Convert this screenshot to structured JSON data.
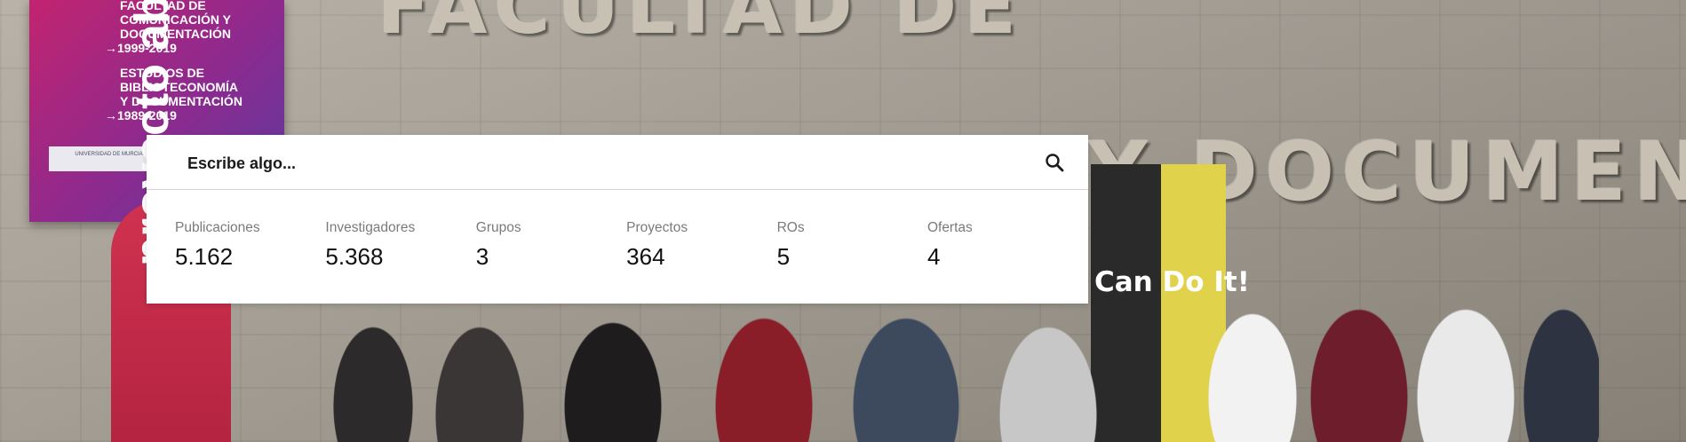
{
  "background": {
    "facade_line_1": "FACULTAD DE",
    "facade_line_2": "Y DOCUMENTAC",
    "poster": {
      "lines": [
        "FACULTAD DE",
        "COMUNICACIÓN Y",
        "DOCUMENTACIÓN",
        "→1999-2019",
        "ESTUDIOS DE",
        "BIBLIOTECONOMÍA",
        "Y DOCUMENTACIÓN",
        "→1989-2019"
      ],
      "logo_text": "UNIVERSIDAD DE MURCIA"
    },
    "banner_left_text": "proyecto abra",
    "banner_right_text": "Can Do It!"
  },
  "search": {
    "placeholder": "Escribe algo...",
    "icon": "search-icon"
  },
  "stats": [
    {
      "label": "Publicaciones",
      "value": "5.162"
    },
    {
      "label": "Investigadores",
      "value": "5.368"
    },
    {
      "label": "Grupos",
      "value": "3"
    },
    {
      "label": "Proyectos",
      "value": "364"
    },
    {
      "label": "ROs",
      "value": "5"
    },
    {
      "label": "Ofertas",
      "value": "4"
    }
  ]
}
